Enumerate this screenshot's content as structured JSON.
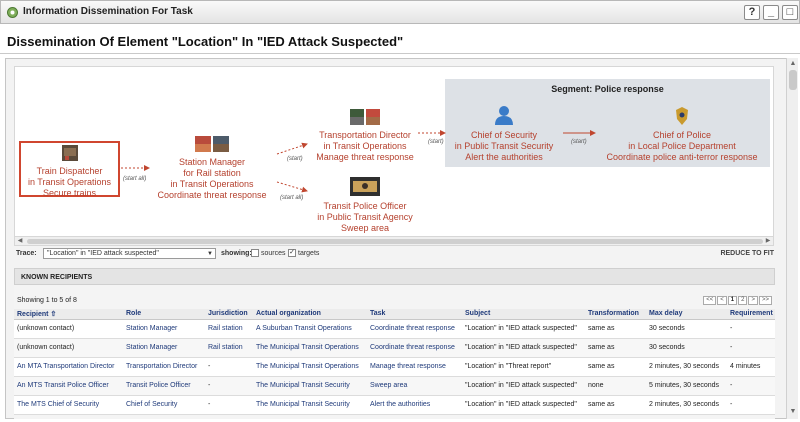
{
  "window": {
    "title": "Information Dissemination For Task",
    "buttons": {
      "help": "?",
      "minimize": "_",
      "maximize": "□"
    }
  },
  "page": {
    "title": "Dissemination Of Element \"Location\" In \"IED Attack Suspected\""
  },
  "diagram": {
    "segment_label": "Segment: Police response",
    "nodes": {
      "train_dispatcher": [
        "Train Dispatcher",
        "in Transit Operations",
        "Secure trains"
      ],
      "station_manager": [
        "Station Manager",
        "for Rail station",
        "in Transit Operations",
        "Coordinate threat response"
      ],
      "transportation_director": [
        "Transportation Director",
        "in Transit Operations",
        "Manage threat response"
      ],
      "transit_police_officer": [
        "Transit Police Officer",
        "in Public Transit Agency",
        "Sweep area"
      ],
      "chief_of_security": [
        "Chief of Security",
        "in Public Transit Security",
        "Alert the authorities"
      ],
      "chief_of_police": [
        "Chief of Police",
        "in Local Police Department",
        "Coordinate police anti-terror response"
      ]
    },
    "links": {
      "start_all": "(start all)",
      "start": "(start)"
    }
  },
  "trace": {
    "label": "Trace:",
    "selected": "\"Location\" in \"IED attack suspected\"",
    "showing_label": "showing:",
    "sources_label": "sources",
    "targets_label": "targets",
    "reduce_to_fit": "REDUCE TO FIT"
  },
  "known_recipients": {
    "header": "KNOWN RECIPIENTS",
    "showing": "Showing 1 to 5 of 8",
    "pager": [
      "<<",
      "<",
      "1",
      "2",
      ">",
      ">>"
    ],
    "columns": [
      "Recipient",
      "Role",
      "Jurisdiction",
      "Actual organization",
      "Task",
      "Subject",
      "Transformation",
      "Max delay",
      "Requirement"
    ],
    "rows": [
      [
        "(unknown contact)",
        "Station Manager",
        "Rail station",
        "A Suburban Transit Operations",
        "Coordinate threat response",
        "\"Location\" in \"IED attack suspected\"",
        "same as",
        "30 seconds",
        "-"
      ],
      [
        "(unknown contact)",
        "Station Manager",
        "Rail station",
        "The Municipal Transit Operations",
        "Coordinate threat response",
        "\"Location\" in \"IED attack suspected\"",
        "same as",
        "30 seconds",
        "-"
      ],
      [
        "An MTA Transportation Director",
        "Transportation Director",
        "-",
        "The Municipal Transit Operations",
        "Manage threat response",
        "\"Location\" in \"Threat report\"",
        "same as",
        "2 minutes, 30 seconds",
        "4 minutes"
      ],
      [
        "An MTS Transit Police Officer",
        "Transit Police Officer",
        "-",
        "The Municipal Transit Security",
        "Sweep area",
        "\"Location\" in \"IED attack suspected\"",
        "none",
        "5 minutes, 30 seconds",
        "-"
      ],
      [
        "The MTS Chief of Security",
        "Chief of Security",
        "-",
        "The Municipal Transit Security",
        "Alert the authorities",
        "\"Location\" in \"IED attack suspected\"",
        "same as",
        "2 minutes, 30 seconds",
        "-"
      ]
    ]
  }
}
